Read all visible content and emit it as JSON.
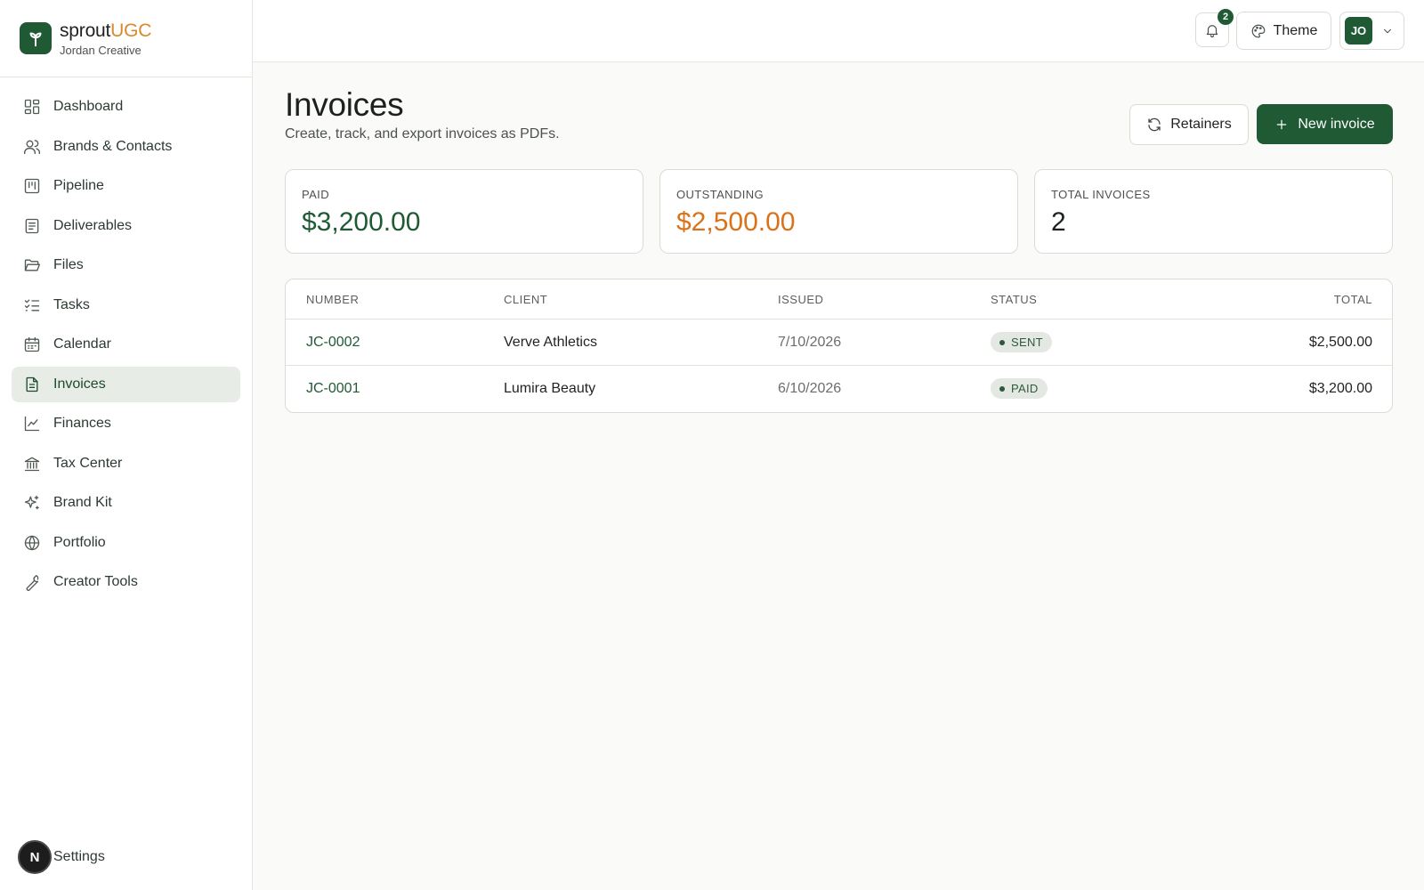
{
  "brand": {
    "name_primary": "sprout",
    "name_accent": "UGC",
    "workspace": "Jordan Creative"
  },
  "sidebar": {
    "items": [
      {
        "label": "Dashboard",
        "icon": "dashboard-icon"
      },
      {
        "label": "Brands & Contacts",
        "icon": "users-icon"
      },
      {
        "label": "Pipeline",
        "icon": "kanban-icon"
      },
      {
        "label": "Deliverables",
        "icon": "clipboard-icon"
      },
      {
        "label": "Files",
        "icon": "folder-icon"
      },
      {
        "label": "Tasks",
        "icon": "checklist-icon"
      },
      {
        "label": "Calendar",
        "icon": "calendar-icon"
      },
      {
        "label": "Invoices",
        "icon": "invoice-icon",
        "active": true
      },
      {
        "label": "Finances",
        "icon": "chart-line-icon"
      },
      {
        "label": "Tax Center",
        "icon": "bank-icon"
      },
      {
        "label": "Brand Kit",
        "icon": "sparkles-icon"
      },
      {
        "label": "Portfolio",
        "icon": "globe-icon"
      },
      {
        "label": "Creator Tools",
        "icon": "wrench-icon"
      }
    ],
    "settings_label": "Settings",
    "settings_avatar": "N"
  },
  "topbar": {
    "notification_count": "2",
    "theme_label": "Theme",
    "user_initials": "JO"
  },
  "page": {
    "title": "Invoices",
    "subtitle": "Create, track, and export invoices as PDFs.",
    "retainers_label": "Retainers",
    "new_invoice_label": "New invoice"
  },
  "stats": [
    {
      "label": "PAID",
      "value": "$3,200.00",
      "color": "#1f5a34"
    },
    {
      "label": "OUTSTANDING",
      "value": "$2,500.00",
      "color": "#d9731a"
    },
    {
      "label": "TOTAL INVOICES",
      "value": "2",
      "color": "#1c211d"
    }
  ],
  "table": {
    "headers": [
      "NUMBER",
      "CLIENT",
      "ISSUED",
      "STATUS",
      "TOTAL"
    ],
    "rows": [
      {
        "number": "JC-0002",
        "client": "Verve Athletics",
        "issued": "7/10/2026",
        "status": "SENT",
        "total": "$2,500.00"
      },
      {
        "number": "JC-0001",
        "client": "Lumira Beauty",
        "issued": "6/10/2026",
        "status": "PAID",
        "total": "$3,200.00"
      }
    ]
  },
  "colors": {
    "brand_green": "#1f5a34",
    "accent_orange": "#d9882e",
    "outstanding_orange": "#d9731a"
  }
}
